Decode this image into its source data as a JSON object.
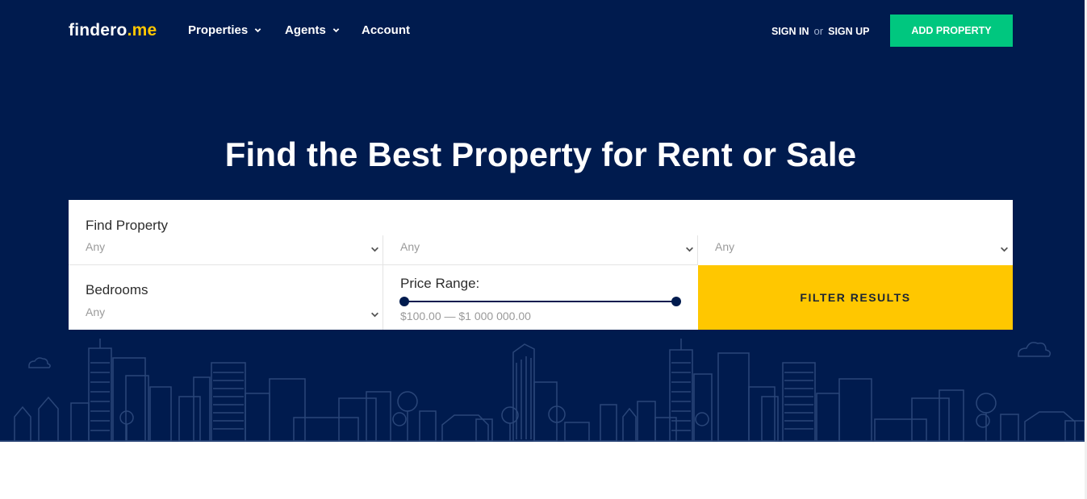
{
  "brand": {
    "name": "findero",
    "suffix": ".me"
  },
  "nav": {
    "items": [
      {
        "label": "Properties",
        "has_dropdown": true
      },
      {
        "label": "Agents",
        "has_dropdown": true
      },
      {
        "label": "Account",
        "has_dropdown": false
      }
    ],
    "sign_in": "SIGN IN",
    "or": "or",
    "sign_up": "SIGN UP",
    "add_property": "ADD PROPERTY"
  },
  "hero": {
    "title": "Find the Best Property for Rent or Sale"
  },
  "search": {
    "find_property": {
      "label": "Find Property",
      "value": "Any"
    },
    "select_2": {
      "value": "Any"
    },
    "select_3": {
      "value": "Any"
    },
    "bedrooms": {
      "label": "Bedrooms",
      "value": "Any"
    },
    "price_range": {
      "label": "Price Range:",
      "value": "$100.00 — $1 000 000.00",
      "min_fraction": 0.0,
      "max_fraction": 1.0
    },
    "filter_button": "FILTER RESULTS"
  },
  "icons": [
    "chevron-down-icon",
    "skyline-illustration"
  ],
  "colors": {
    "navy": "#001b4e",
    "green": "#00c77f",
    "yellow": "#ffc700",
    "logo_accent": "#ffc700"
  }
}
